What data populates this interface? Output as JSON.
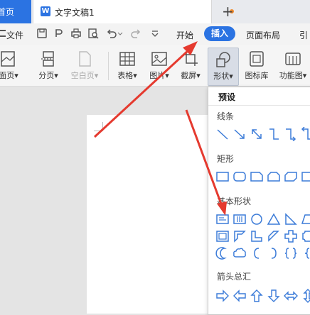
{
  "tabs": {
    "home_label": "首页",
    "doc_title": "文字文稿1",
    "doc_icon": "W",
    "new_tab": "+"
  },
  "menu": {
    "file": "文件",
    "start": "开始",
    "insert": "插入",
    "layout": "页面布局",
    "ref": "引"
  },
  "ribbon": {
    "cover": "面页",
    "page_break": "分页",
    "blank_page": "空白页",
    "table": "表格",
    "picture": "图片",
    "screenshot": "截屏",
    "shapes": "形状",
    "icons": "图标库",
    "function_chart": "功能图"
  },
  "dropdown": {
    "preset": "预设",
    "lines": "线条",
    "rectangles": "矩形",
    "basic": "基本形状",
    "arrows": "箭头总汇"
  },
  "colors": {
    "accent": "#2b73e2",
    "arrow_red": "#e53a2f",
    "modified_dot": "#f08a2c"
  }
}
